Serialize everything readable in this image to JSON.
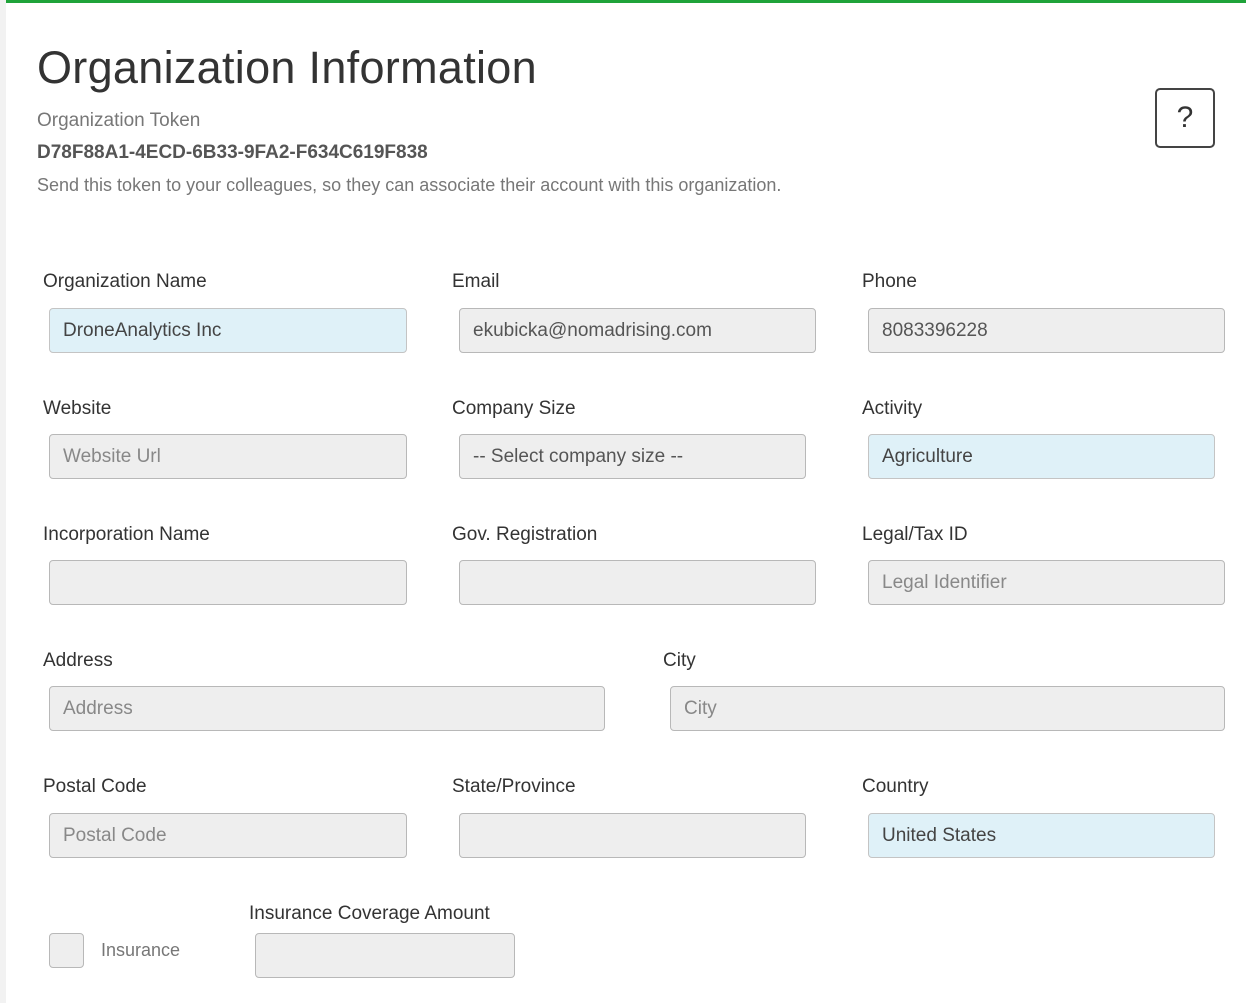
{
  "header": {
    "title": "Organization Information",
    "token_label": "Organization Token",
    "token_value": "D78F88A1-4ECD-6B33-9FA2-F634C619F838",
    "token_help": "Send this token to your colleagues, so they can associate their account with this organization.",
    "help_button": "?"
  },
  "form": {
    "org_name": {
      "label": "Organization Name",
      "value": "DroneAnalytics Inc"
    },
    "email": {
      "label": "Email",
      "value": "ekubicka@nomadrising.com"
    },
    "phone": {
      "label": "Phone",
      "value": "8083396228"
    },
    "website": {
      "label": "Website",
      "placeholder": "Website Url"
    },
    "company_size": {
      "label": "Company Size",
      "value": "-- Select company size --"
    },
    "activity": {
      "label": "Activity",
      "value": "Agriculture"
    },
    "incorporation_name": {
      "label": "Incorporation Name"
    },
    "gov_registration": {
      "label": "Gov. Registration"
    },
    "legal_tax_id": {
      "label": "Legal/Tax ID",
      "placeholder": "Legal Identifier"
    },
    "address": {
      "label": "Address",
      "placeholder": "Address"
    },
    "city": {
      "label": "City",
      "placeholder": "City"
    },
    "postal_code": {
      "label": "Postal Code",
      "placeholder": "Postal Code"
    },
    "state_province": {
      "label": "State/Province"
    },
    "country": {
      "label": "Country",
      "value": "United States"
    },
    "insurance": {
      "label": "Insurance",
      "checked": false
    },
    "insurance_amount": {
      "label": "Insurance Coverage Amount"
    }
  },
  "colors": {
    "accent_line": "#1fa33a",
    "filled_field_bg": "#dff1f8",
    "empty_field_bg": "#eeeeee"
  }
}
